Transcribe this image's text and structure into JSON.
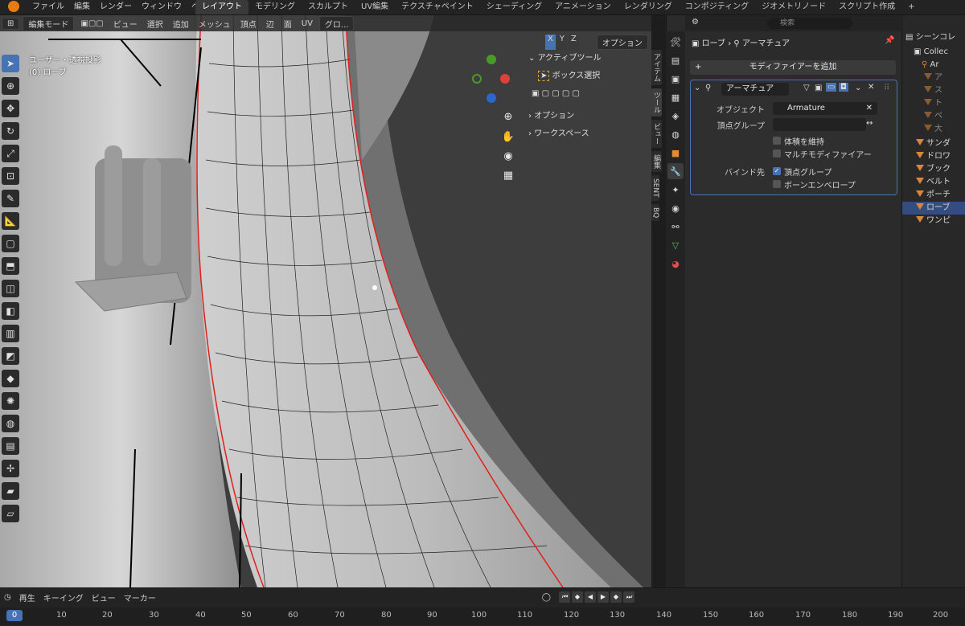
{
  "topbar": {
    "menus": [
      "ファイル",
      "編集",
      "レンダー",
      "ウィンドウ",
      "ヘルプ"
    ],
    "workspaces": [
      "レイアウト",
      "モデリング",
      "スカルプト",
      "UV編集",
      "テクスチャペイント",
      "シェーディング",
      "アニメーション",
      "レンダリング",
      "コンポジティング",
      "ジオメトリノード",
      "スクリプト作成",
      "+"
    ],
    "active_workspace": "レイアウト"
  },
  "viewport": {
    "mode": "編集モード",
    "menus": [
      "ビュー",
      "選択",
      "追加",
      "メッシュ",
      "頂点",
      "辺",
      "面",
      "UV"
    ],
    "transform_orientation": "グロ...",
    "info_line1": "ユーザー・透視投影",
    "info_line2": "(0) ローブ",
    "options_label": "オプション",
    "axis_x": "X",
    "axis_y": "Y",
    "axis_z": "Z"
  },
  "toolpanel": {
    "header": "アクティブツール",
    "tool": "ボックス選択",
    "options": "オプション",
    "workspace": "ワークスペース"
  },
  "ntabs": [
    "アイテム",
    "ツール",
    "ビュー",
    "編集",
    "SENT",
    "BQ"
  ],
  "properties": {
    "search_placeholder": "検索",
    "breadcrumb_object": "ローブ",
    "breadcrumb_modifier": "アーマチュア",
    "add_modifier": "モディファイアーを追加",
    "modifier_name": "アーマチュア",
    "object_label": "オブジェクト",
    "object_value": "Armature",
    "vgroup_label": "頂点グループ",
    "preserve_volume": "体積を維持",
    "multi_modifier": "マルチモディファイアー",
    "bind_to_label": "バインド先",
    "bind_vgroups": "頂点グループ",
    "bind_envelopes": "ボーンエンベロープ"
  },
  "outliner": {
    "rows": [
      {
        "label": "シーンコレ",
        "kind": "scene"
      },
      {
        "label": "Collec",
        "kind": "collection"
      },
      {
        "label": "Ar",
        "kind": "armature"
      },
      {
        "label": "ア",
        "kind": "mesh-dim"
      },
      {
        "label": "ス",
        "kind": "mesh-dim"
      },
      {
        "label": "ト",
        "kind": "mesh-dim"
      },
      {
        "label": "ペ",
        "kind": "mesh-dim"
      },
      {
        "label": "大",
        "kind": "mesh-dim"
      },
      {
        "label": "サンダ",
        "kind": "mesh"
      },
      {
        "label": "ドロワ",
        "kind": "mesh"
      },
      {
        "label": "ブック",
        "kind": "mesh"
      },
      {
        "label": "ベルト",
        "kind": "mesh"
      },
      {
        "label": "ポーチ",
        "kind": "mesh"
      },
      {
        "label": "ローブ",
        "kind": "mesh-selected"
      },
      {
        "label": "ワンピ",
        "kind": "mesh"
      }
    ]
  },
  "timeline": {
    "menus": [
      "再生",
      "キーイング",
      "ビュー",
      "マーカー"
    ],
    "current_frame": "0",
    "ticks": [
      "10",
      "20",
      "30",
      "40",
      "50",
      "60",
      "70",
      "80",
      "90",
      "100",
      "110",
      "120",
      "130",
      "140",
      "150",
      "160",
      "170",
      "180",
      "190",
      "200"
    ]
  },
  "colors": {
    "accent": "#4772b3",
    "seam": "#e0201c",
    "mesh_surface": "#bdbdbd",
    "viewport_bg": "#3d3d3d"
  }
}
